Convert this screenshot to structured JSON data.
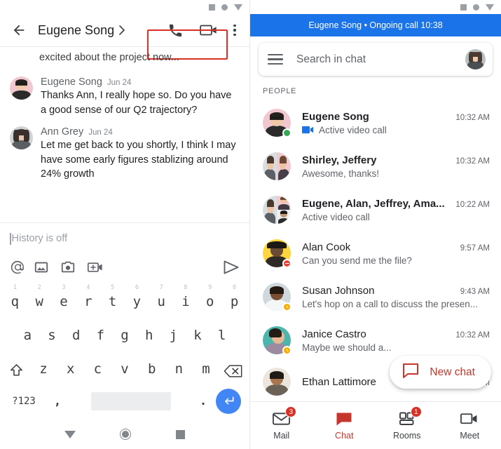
{
  "left": {
    "statusbar": {
      "icons": [
        "square-icon",
        "circle-icon",
        "triangle-icon"
      ]
    },
    "header": {
      "back_icon": "back-arrow-icon",
      "title": "Eugene Song",
      "caret_icon": "chevron-right-icon",
      "call_icon": "phone-icon",
      "video_icon": "video-camera-icon",
      "overflow_icon": "more-vertical-icon"
    },
    "highlight": {
      "color": "#d93025",
      "targets": "call-and-video-buttons"
    },
    "partial_message": "excited about the project now...",
    "messages": [
      {
        "name": "Eugene Song",
        "time": "Jun 24",
        "text": "Thanks Ann, I really hope so. Do you have a good sense of our Q2 trajectory?",
        "avatar": "eugene-song-avatar"
      },
      {
        "name": "Ann Grey",
        "time": "Jun 24",
        "text": "Let me get back to you shortly, I think I may have some early figures stablizing around 24% growth",
        "avatar": "ann-grey-avatar"
      }
    ],
    "composer": {
      "placeholder": "History is off",
      "value": "",
      "icons": [
        "mention-icon",
        "image-icon",
        "camera-icon",
        "add-video-icon"
      ],
      "send_icon": "send-icon"
    },
    "keyboard": {
      "row1": [
        {
          "key": "q",
          "num": "1"
        },
        {
          "key": "w",
          "num": "2"
        },
        {
          "key": "e",
          "num": "3"
        },
        {
          "key": "r",
          "num": "4"
        },
        {
          "key": "t",
          "num": "5"
        },
        {
          "key": "y",
          "num": "6"
        },
        {
          "key": "u",
          "num": "7"
        },
        {
          "key": "i",
          "num": "8"
        },
        {
          "key": "o",
          "num": "9"
        },
        {
          "key": "p",
          "num": "0"
        }
      ],
      "row2": [
        "a",
        "s",
        "d",
        "f",
        "g",
        "h",
        "j",
        "k",
        "l"
      ],
      "row3": [
        "z",
        "x",
        "c",
        "v",
        "b",
        "n",
        "m"
      ],
      "shift_icon": "shift-up-arrow-icon",
      "backspace_icon": "backspace-icon",
      "symbols_key": "?123",
      "comma_key": ",",
      "period_key": ".",
      "space_key": "",
      "enter_icon": "enter-return-icon",
      "enter_color": "#4285f4"
    },
    "sysnav": {
      "back_icon": "nav-back-triangle-icon",
      "home_icon": "nav-home-circle-icon",
      "recents_icon": "nav-recents-square-icon"
    }
  },
  "right": {
    "statusbar": {
      "icons": [
        "square-icon",
        "circle-icon",
        "triangle-icon"
      ]
    },
    "call_banner": {
      "text": "Eugene Song • Ongoing call 10:38",
      "color": "#1a73e8"
    },
    "search": {
      "menu_icon": "hamburger-menu-icon",
      "placeholder": "Search in chat",
      "value": "",
      "avatar": "current-user-avatar"
    },
    "section_label": "PEOPLE",
    "people": [
      {
        "name": "Eugene Song",
        "time": "10:32 AM",
        "subtitle": "Active video call",
        "has_video_icon": true,
        "status": "online",
        "unread": true,
        "avatar_type": "single"
      },
      {
        "name": "Shirley, Jeffery",
        "time": "10:32 AM",
        "subtitle": "Awesome, thanks!",
        "has_video_icon": false,
        "status": "none",
        "unread": true,
        "avatar_type": "split2"
      },
      {
        "name": "Eugene, Alan, Jeffrey, Ama...",
        "time": "10:22 AM",
        "subtitle": "Active video call",
        "has_video_icon": false,
        "status": "none",
        "unread": true,
        "avatar_type": "split3"
      },
      {
        "name": "Alan Cook",
        "time": "9:57 AM",
        "subtitle": "Can you send me the file?",
        "has_video_icon": false,
        "status": "dnd",
        "unread": false,
        "avatar_type": "single"
      },
      {
        "name": "Susan Johnson",
        "time": "9:43 AM",
        "subtitle": "Let's hop on a call to discuss the presen...",
        "has_video_icon": false,
        "status": "away",
        "unread": false,
        "avatar_type": "single"
      },
      {
        "name": "Janice Castro",
        "time": "10:32 AM",
        "subtitle": "Maybe we should a...",
        "has_video_icon": false,
        "status": "away",
        "unread": false,
        "avatar_type": "single"
      },
      {
        "name": "Ethan Lattimore",
        "time": "9:07 AM",
        "subtitle": "",
        "has_video_icon": false,
        "status": "none",
        "unread": false,
        "avatar_type": "single"
      }
    ],
    "fab": {
      "icon": "chat-bubble-icon",
      "label": "New chat",
      "color": "#c5372c"
    },
    "bottom_nav": [
      {
        "label": "Mail",
        "icon": "mail-envelope-icon",
        "badge": "3",
        "active": false
      },
      {
        "label": "Chat",
        "icon": "chat-bubble-filled-icon",
        "badge": "",
        "active": true
      },
      {
        "label": "Rooms",
        "icon": "rooms-grid-icon",
        "badge": "1",
        "active": false
      },
      {
        "label": "Meet",
        "icon": "video-camera-icon",
        "badge": "",
        "active": false
      }
    ]
  }
}
